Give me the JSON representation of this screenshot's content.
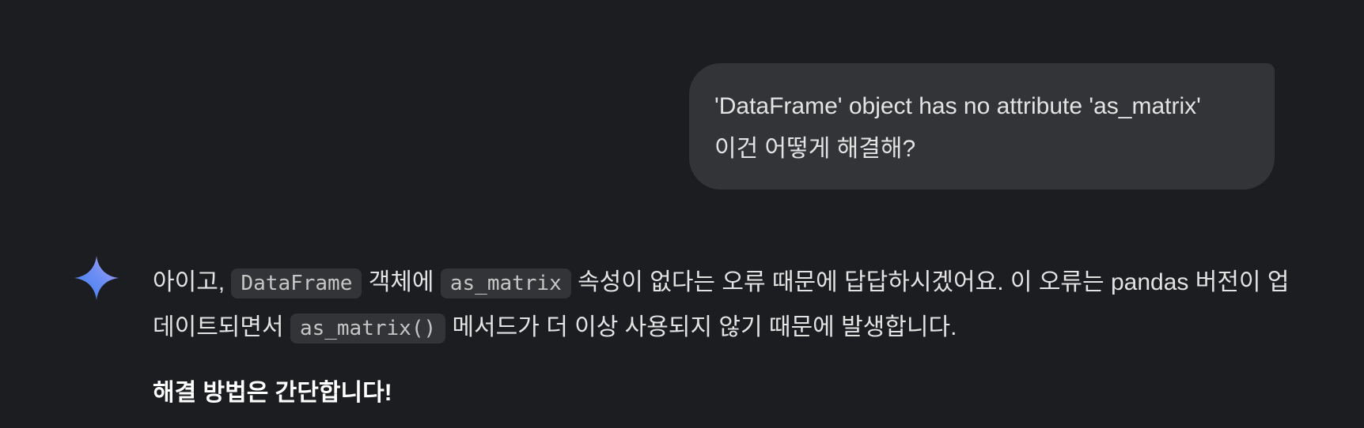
{
  "user_message": {
    "line1": "'DataFrame' object has no attribute 'as_matrix'",
    "line2": "이건 어떻게 해결해?"
  },
  "assistant": {
    "icon": "gemini-sparkle-icon",
    "para1": {
      "t1": "아이고, ",
      "code1": "DataFrame",
      "t2": " 객체에 ",
      "code2": "as_matrix",
      "t3": " 속성이 없다는 오류 때문에 답답하시겠어요. 이 오류는 pandas 버전이 업데이트되면서 ",
      "code3": "as_matrix()",
      "t4": " 메서드가 더 이상 사용되지 않기 때문에 발생합니다."
    },
    "heading": "해결 방법은 간단합니다!"
  },
  "colors": {
    "background": "#1c1d20",
    "bubble": "#333437",
    "text": "#e3e3e3",
    "code_bg": "#333437"
  }
}
